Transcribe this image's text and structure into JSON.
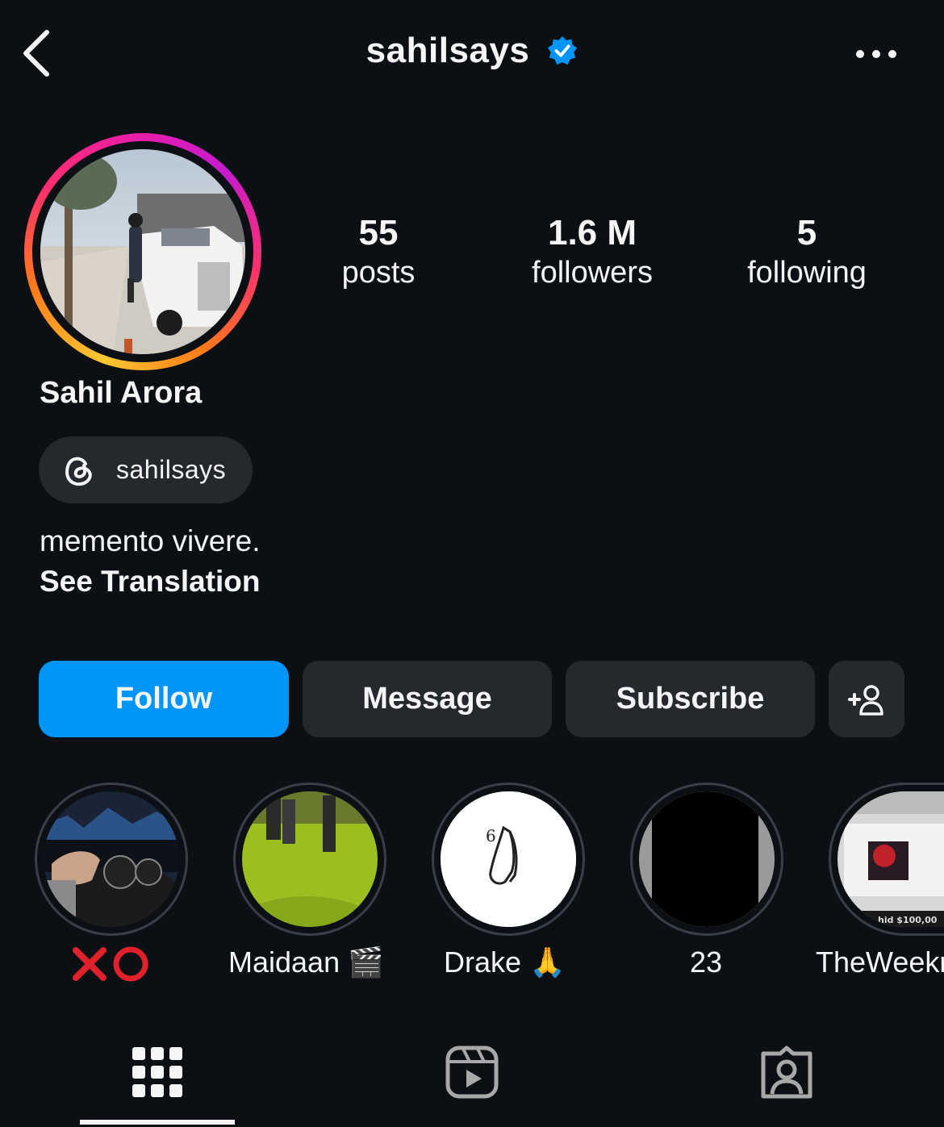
{
  "header": {
    "username": "sahilsays",
    "verified_icon": "verified-badge-icon",
    "back_icon": "chevron-left-icon",
    "more_icon": "more-horizontal-icon"
  },
  "profile": {
    "display_name": "Sahil Arora",
    "threads_handle": "sahilsays",
    "bio": "memento vivere.",
    "see_translation": "See Translation",
    "story_ring_colors": [
      "#fdc830",
      "#ff7a1a",
      "#ff2f6d",
      "#c51bd0"
    ]
  },
  "stats": [
    {
      "value": "55",
      "label": "posts"
    },
    {
      "value": "1.6 M",
      "label": "followers"
    },
    {
      "value": "5",
      "label": "following"
    }
  ],
  "actions": {
    "follow": "Follow",
    "message": "Message",
    "subscribe": "Subscribe",
    "add_icon": "add-person-icon",
    "follow_color": "#0095f6"
  },
  "highlights": [
    {
      "label": "❌⭕"
    },
    {
      "label": "Maidaan 🎬"
    },
    {
      "label": "Drake 🙏"
    },
    {
      "label": "23"
    },
    {
      "label": "TheWeekr"
    }
  ],
  "tabs": [
    {
      "icon": "grid-icon",
      "selected": true
    },
    {
      "icon": "reels-icon",
      "selected": false
    },
    {
      "icon": "tagged-icon",
      "selected": false
    }
  ]
}
